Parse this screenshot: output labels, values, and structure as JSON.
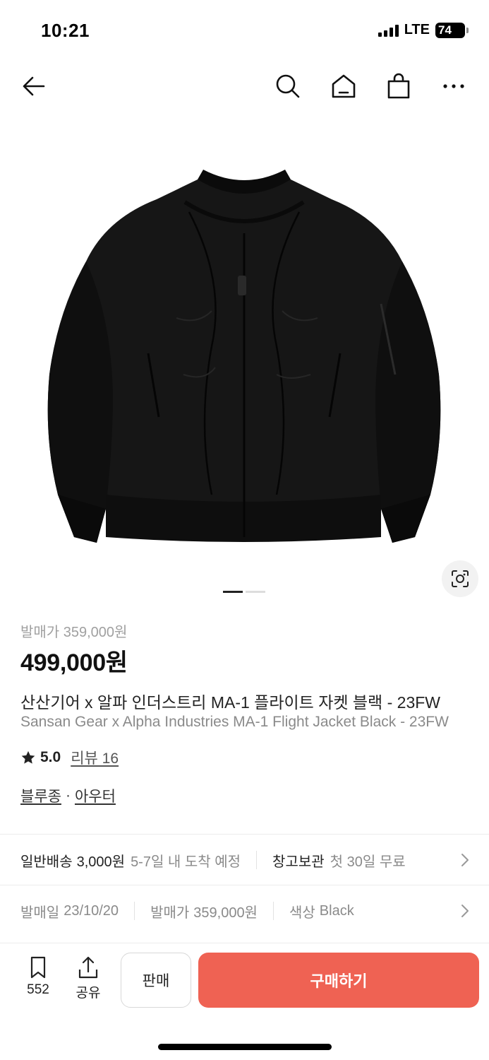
{
  "status_bar": {
    "time": "10:21",
    "network": "LTE",
    "battery": "74"
  },
  "nav": {
    "icons": [
      "back-arrow-icon",
      "search-icon",
      "home-icon",
      "shopping-bag-icon",
      "more-icon"
    ]
  },
  "product": {
    "image": "black-bomber-jacket-image",
    "carousel": {
      "current": 1,
      "total": 2
    },
    "release_price_label": "발매가 359,000원",
    "price": "499,000원",
    "title_ko": "산산기어 x 알파 인더스트리 MA-1 플라이트 자켓 블랙 - 23FW",
    "title_en": "Sansan Gear x Alpha Industries MA-1 Flight Jacket Black - 23FW",
    "rating": "5.0",
    "review_label": "리뷰 16",
    "categories": [
      "블루종",
      "아우터"
    ],
    "category_separator": "·"
  },
  "shipping": {
    "standard_label": "일반배송",
    "standard_price": "3,000원",
    "standard_eta": "5-7일 내 도착 예정",
    "storage_label": "창고보관",
    "storage_note": "첫 30일 무료"
  },
  "info": {
    "release_date_label": "발매일",
    "release_date": "23/10/20",
    "release_price_label": "발매가",
    "release_price": "359,000원",
    "color_label": "색상",
    "color": "Black"
  },
  "bottom_bar": {
    "save_count": "552",
    "share_label": "공유",
    "sell_label": "판매",
    "buy_label": "구매하기"
  },
  "colors": {
    "accent": "#ef6253",
    "muted": "#8a8a8a",
    "text": "#222222"
  }
}
